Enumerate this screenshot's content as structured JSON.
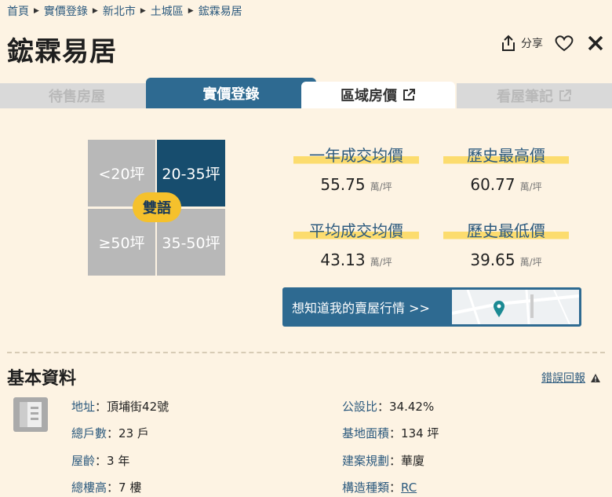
{
  "breadcrumb": [
    "首頁",
    "實價登錄",
    "新北市",
    "土城區",
    "鋐霖易居"
  ],
  "title": "鋐霖易居",
  "actions": {
    "share_label": "分享"
  },
  "tabs": [
    {
      "label": "待售房屋",
      "state": "inactive"
    },
    {
      "label": "實價登錄",
      "state": "active"
    },
    {
      "label": "區域房價",
      "state": "link"
    },
    {
      "label": "看屋筆記",
      "state": "inactive-link"
    }
  ],
  "size_grid": {
    "cells": [
      "<20坪",
      "20-35坪",
      "≥50坪",
      "35-50坪"
    ],
    "selected": "20-35坪",
    "badge": "雙語"
  },
  "stats": [
    {
      "label": "一年成交均價",
      "value": "55.75",
      "unit": "萬/坪"
    },
    {
      "label": "歷史最高價",
      "value": "60.77",
      "unit": "萬/坪"
    },
    {
      "label": "平均成交均價",
      "value": "43.13",
      "unit": "萬/坪"
    },
    {
      "label": "歷史最低價",
      "value": "39.65",
      "unit": "萬/坪"
    }
  ],
  "banner": {
    "text": "想知道我的賣屋行情 >>"
  },
  "basic": {
    "title": "基本資料",
    "report_label": "錯誤回報",
    "left": [
      {
        "key": "地址",
        "value": "頂埔街42號"
      },
      {
        "key": "總戶數",
        "value": "23 戶"
      },
      {
        "key": "屋齡",
        "value": "3 年"
      },
      {
        "key": "總樓高",
        "value": "7 樓"
      }
    ],
    "right": [
      {
        "key": "公設比",
        "value": "34.42%"
      },
      {
        "key": "基地面積",
        "value": "134 坪"
      },
      {
        "key": "建案規劃",
        "value": "華廈"
      },
      {
        "key": "構造種類",
        "value": "RC"
      }
    ]
  },
  "colors": {
    "accent": "#2e6a91",
    "selected_cell": "#174d6e",
    "badge": "#f5c12c",
    "highlight": "#fcdc6e",
    "background": "#fdf3e3"
  }
}
